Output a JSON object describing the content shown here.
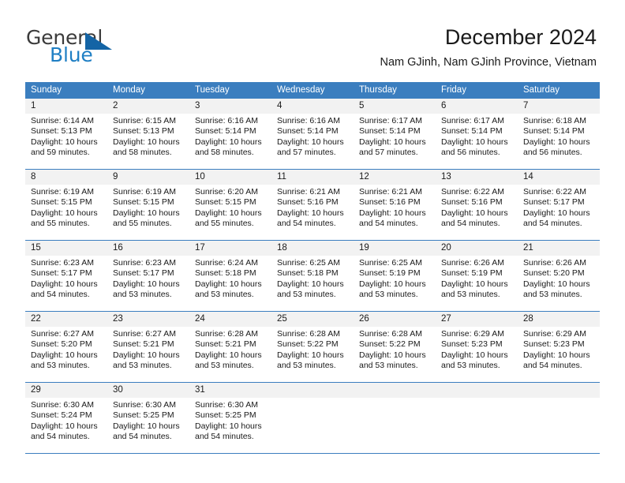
{
  "brand": {
    "name_part1": "General",
    "name_part2": "Blue",
    "accent_color": "#1f7fc4",
    "triangle_color": "#1464a5"
  },
  "header": {
    "title": "December 2024",
    "subtitle": "Nam GJinh, Nam GJinh Province, Vietnam"
  },
  "calendar": {
    "header_bg": "#3b7ebf",
    "daynum_bg": "#f2f2f2",
    "weekdays": [
      "Sunday",
      "Monday",
      "Tuesday",
      "Wednesday",
      "Thursday",
      "Friday",
      "Saturday"
    ],
    "weeks": [
      [
        {
          "day": "1",
          "sunrise": "Sunrise: 6:14 AM",
          "sunset": "Sunset: 5:13 PM",
          "daylight_1": "Daylight: 10 hours",
          "daylight_2": "and 59 minutes."
        },
        {
          "day": "2",
          "sunrise": "Sunrise: 6:15 AM",
          "sunset": "Sunset: 5:13 PM",
          "daylight_1": "Daylight: 10 hours",
          "daylight_2": "and 58 minutes."
        },
        {
          "day": "3",
          "sunrise": "Sunrise: 6:16 AM",
          "sunset": "Sunset: 5:14 PM",
          "daylight_1": "Daylight: 10 hours",
          "daylight_2": "and 58 minutes."
        },
        {
          "day": "4",
          "sunrise": "Sunrise: 6:16 AM",
          "sunset": "Sunset: 5:14 PM",
          "daylight_1": "Daylight: 10 hours",
          "daylight_2": "and 57 minutes."
        },
        {
          "day": "5",
          "sunrise": "Sunrise: 6:17 AM",
          "sunset": "Sunset: 5:14 PM",
          "daylight_1": "Daylight: 10 hours",
          "daylight_2": "and 57 minutes."
        },
        {
          "day": "6",
          "sunrise": "Sunrise: 6:17 AM",
          "sunset": "Sunset: 5:14 PM",
          "daylight_1": "Daylight: 10 hours",
          "daylight_2": "and 56 minutes."
        },
        {
          "day": "7",
          "sunrise": "Sunrise: 6:18 AM",
          "sunset": "Sunset: 5:14 PM",
          "daylight_1": "Daylight: 10 hours",
          "daylight_2": "and 56 minutes."
        }
      ],
      [
        {
          "day": "8",
          "sunrise": "Sunrise: 6:19 AM",
          "sunset": "Sunset: 5:15 PM",
          "daylight_1": "Daylight: 10 hours",
          "daylight_2": "and 55 minutes."
        },
        {
          "day": "9",
          "sunrise": "Sunrise: 6:19 AM",
          "sunset": "Sunset: 5:15 PM",
          "daylight_1": "Daylight: 10 hours",
          "daylight_2": "and 55 minutes."
        },
        {
          "day": "10",
          "sunrise": "Sunrise: 6:20 AM",
          "sunset": "Sunset: 5:15 PM",
          "daylight_1": "Daylight: 10 hours",
          "daylight_2": "and 55 minutes."
        },
        {
          "day": "11",
          "sunrise": "Sunrise: 6:21 AM",
          "sunset": "Sunset: 5:16 PM",
          "daylight_1": "Daylight: 10 hours",
          "daylight_2": "and 54 minutes."
        },
        {
          "day": "12",
          "sunrise": "Sunrise: 6:21 AM",
          "sunset": "Sunset: 5:16 PM",
          "daylight_1": "Daylight: 10 hours",
          "daylight_2": "and 54 minutes."
        },
        {
          "day": "13",
          "sunrise": "Sunrise: 6:22 AM",
          "sunset": "Sunset: 5:16 PM",
          "daylight_1": "Daylight: 10 hours",
          "daylight_2": "and 54 minutes."
        },
        {
          "day": "14",
          "sunrise": "Sunrise: 6:22 AM",
          "sunset": "Sunset: 5:17 PM",
          "daylight_1": "Daylight: 10 hours",
          "daylight_2": "and 54 minutes."
        }
      ],
      [
        {
          "day": "15",
          "sunrise": "Sunrise: 6:23 AM",
          "sunset": "Sunset: 5:17 PM",
          "daylight_1": "Daylight: 10 hours",
          "daylight_2": "and 54 minutes."
        },
        {
          "day": "16",
          "sunrise": "Sunrise: 6:23 AM",
          "sunset": "Sunset: 5:17 PM",
          "daylight_1": "Daylight: 10 hours",
          "daylight_2": "and 53 minutes."
        },
        {
          "day": "17",
          "sunrise": "Sunrise: 6:24 AM",
          "sunset": "Sunset: 5:18 PM",
          "daylight_1": "Daylight: 10 hours",
          "daylight_2": "and 53 minutes."
        },
        {
          "day": "18",
          "sunrise": "Sunrise: 6:25 AM",
          "sunset": "Sunset: 5:18 PM",
          "daylight_1": "Daylight: 10 hours",
          "daylight_2": "and 53 minutes."
        },
        {
          "day": "19",
          "sunrise": "Sunrise: 6:25 AM",
          "sunset": "Sunset: 5:19 PM",
          "daylight_1": "Daylight: 10 hours",
          "daylight_2": "and 53 minutes."
        },
        {
          "day": "20",
          "sunrise": "Sunrise: 6:26 AM",
          "sunset": "Sunset: 5:19 PM",
          "daylight_1": "Daylight: 10 hours",
          "daylight_2": "and 53 minutes."
        },
        {
          "day": "21",
          "sunrise": "Sunrise: 6:26 AM",
          "sunset": "Sunset: 5:20 PM",
          "daylight_1": "Daylight: 10 hours",
          "daylight_2": "and 53 minutes."
        }
      ],
      [
        {
          "day": "22",
          "sunrise": "Sunrise: 6:27 AM",
          "sunset": "Sunset: 5:20 PM",
          "daylight_1": "Daylight: 10 hours",
          "daylight_2": "and 53 minutes."
        },
        {
          "day": "23",
          "sunrise": "Sunrise: 6:27 AM",
          "sunset": "Sunset: 5:21 PM",
          "daylight_1": "Daylight: 10 hours",
          "daylight_2": "and 53 minutes."
        },
        {
          "day": "24",
          "sunrise": "Sunrise: 6:28 AM",
          "sunset": "Sunset: 5:21 PM",
          "daylight_1": "Daylight: 10 hours",
          "daylight_2": "and 53 minutes."
        },
        {
          "day": "25",
          "sunrise": "Sunrise: 6:28 AM",
          "sunset": "Sunset: 5:22 PM",
          "daylight_1": "Daylight: 10 hours",
          "daylight_2": "and 53 minutes."
        },
        {
          "day": "26",
          "sunrise": "Sunrise: 6:28 AM",
          "sunset": "Sunset: 5:22 PM",
          "daylight_1": "Daylight: 10 hours",
          "daylight_2": "and 53 minutes."
        },
        {
          "day": "27",
          "sunrise": "Sunrise: 6:29 AM",
          "sunset": "Sunset: 5:23 PM",
          "daylight_1": "Daylight: 10 hours",
          "daylight_2": "and 53 minutes."
        },
        {
          "day": "28",
          "sunrise": "Sunrise: 6:29 AM",
          "sunset": "Sunset: 5:23 PM",
          "daylight_1": "Daylight: 10 hours",
          "daylight_2": "and 54 minutes."
        }
      ],
      [
        {
          "day": "29",
          "sunrise": "Sunrise: 6:30 AM",
          "sunset": "Sunset: 5:24 PM",
          "daylight_1": "Daylight: 10 hours",
          "daylight_2": "and 54 minutes."
        },
        {
          "day": "30",
          "sunrise": "Sunrise: 6:30 AM",
          "sunset": "Sunset: 5:25 PM",
          "daylight_1": "Daylight: 10 hours",
          "daylight_2": "and 54 minutes."
        },
        {
          "day": "31",
          "sunrise": "Sunrise: 6:30 AM",
          "sunset": "Sunset: 5:25 PM",
          "daylight_1": "Daylight: 10 hours",
          "daylight_2": "and 54 minutes."
        },
        {
          "day": "",
          "sunrise": "",
          "sunset": "",
          "daylight_1": "",
          "daylight_2": ""
        },
        {
          "day": "",
          "sunrise": "",
          "sunset": "",
          "daylight_1": "",
          "daylight_2": ""
        },
        {
          "day": "",
          "sunrise": "",
          "sunset": "",
          "daylight_1": "",
          "daylight_2": ""
        },
        {
          "day": "",
          "sunrise": "",
          "sunset": "",
          "daylight_1": "",
          "daylight_2": ""
        }
      ]
    ]
  }
}
